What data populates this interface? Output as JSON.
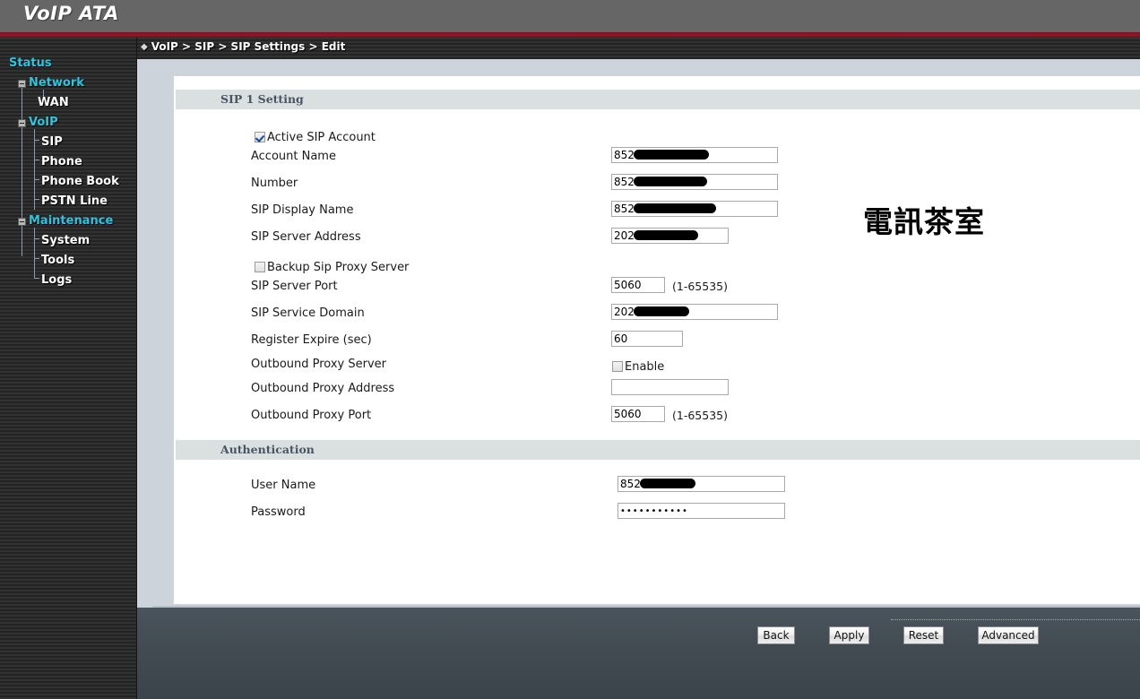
{
  "header": {
    "app_title": "VoIP ATA"
  },
  "breadcrumb": {
    "diamond": "diamond-icon",
    "text": "VoIP > SIP > SIP Settings > Edit"
  },
  "sidebar": {
    "items": [
      {
        "label": "Status",
        "level": "top",
        "expander": false
      },
      {
        "label": "Network",
        "level": "group",
        "expander": true
      },
      {
        "label": "WAN",
        "level": "child",
        "expander": false
      },
      {
        "label": "VoIP",
        "level": "group",
        "expander": true
      },
      {
        "label": "SIP",
        "level": "child",
        "expander": false
      },
      {
        "label": "Phone",
        "level": "child",
        "expander": false
      },
      {
        "label": "Phone Book",
        "level": "child",
        "expander": false
      },
      {
        "label": "PSTN Line",
        "level": "child",
        "expander": false
      },
      {
        "label": "Maintenance",
        "level": "group",
        "expander": true
      },
      {
        "label": "System",
        "level": "child",
        "expander": false
      },
      {
        "label": "Tools",
        "level": "child",
        "expander": false
      },
      {
        "label": "Logs",
        "level": "child",
        "expander": false
      }
    ]
  },
  "sections": {
    "sip1": {
      "title": "SIP 1 Setting"
    },
    "auth": {
      "title": "Authentication"
    }
  },
  "fields": {
    "active_sip_account": {
      "label": "Active SIP Account",
      "checked": true
    },
    "account_name": {
      "label": "Account Name",
      "value": "852"
    },
    "number": {
      "label": "Number",
      "value": "852"
    },
    "sip_display_name": {
      "label": "SIP Display Name",
      "value": "852"
    },
    "sip_server_address": {
      "label": "SIP Server Address",
      "value": "202"
    },
    "backup_sip_proxy": {
      "label": "Backup Sip Proxy Server",
      "checked": false
    },
    "sip_server_port": {
      "label": "SIP Server Port",
      "value": "5060",
      "hint": "(1-65535)"
    },
    "sip_service_domain": {
      "label": "SIP Service Domain",
      "value": "202"
    },
    "register_expire": {
      "label": "Register Expire (sec)",
      "value": "60"
    },
    "outbound_proxy_server": {
      "label": "Outbound Proxy Server",
      "checkbox_label": "Enable",
      "checked": false
    },
    "outbound_proxy_address": {
      "label": "Outbound Proxy Address",
      "value": ""
    },
    "outbound_proxy_port": {
      "label": "Outbound Proxy Port",
      "value": "5060",
      "hint": "(1-65535)"
    },
    "user_name": {
      "label": "User Name",
      "value": "852"
    },
    "password": {
      "label": "Password",
      "value": "•••••••••••"
    }
  },
  "buttons": {
    "back": "Back",
    "apply": "Apply",
    "reset": "Reset",
    "advanced": "Advanced"
  },
  "watermark": {
    "text": "電訊茶室"
  },
  "colors": {
    "header_bg": "#666666",
    "red_stripe": "#8e1a2c",
    "nav_group": "#27c8e0",
    "nav_child": "#ffffff",
    "section_bar": "#dae0e0",
    "panel_outer": "#ccd3db",
    "content_bg": "#ffffff"
  }
}
